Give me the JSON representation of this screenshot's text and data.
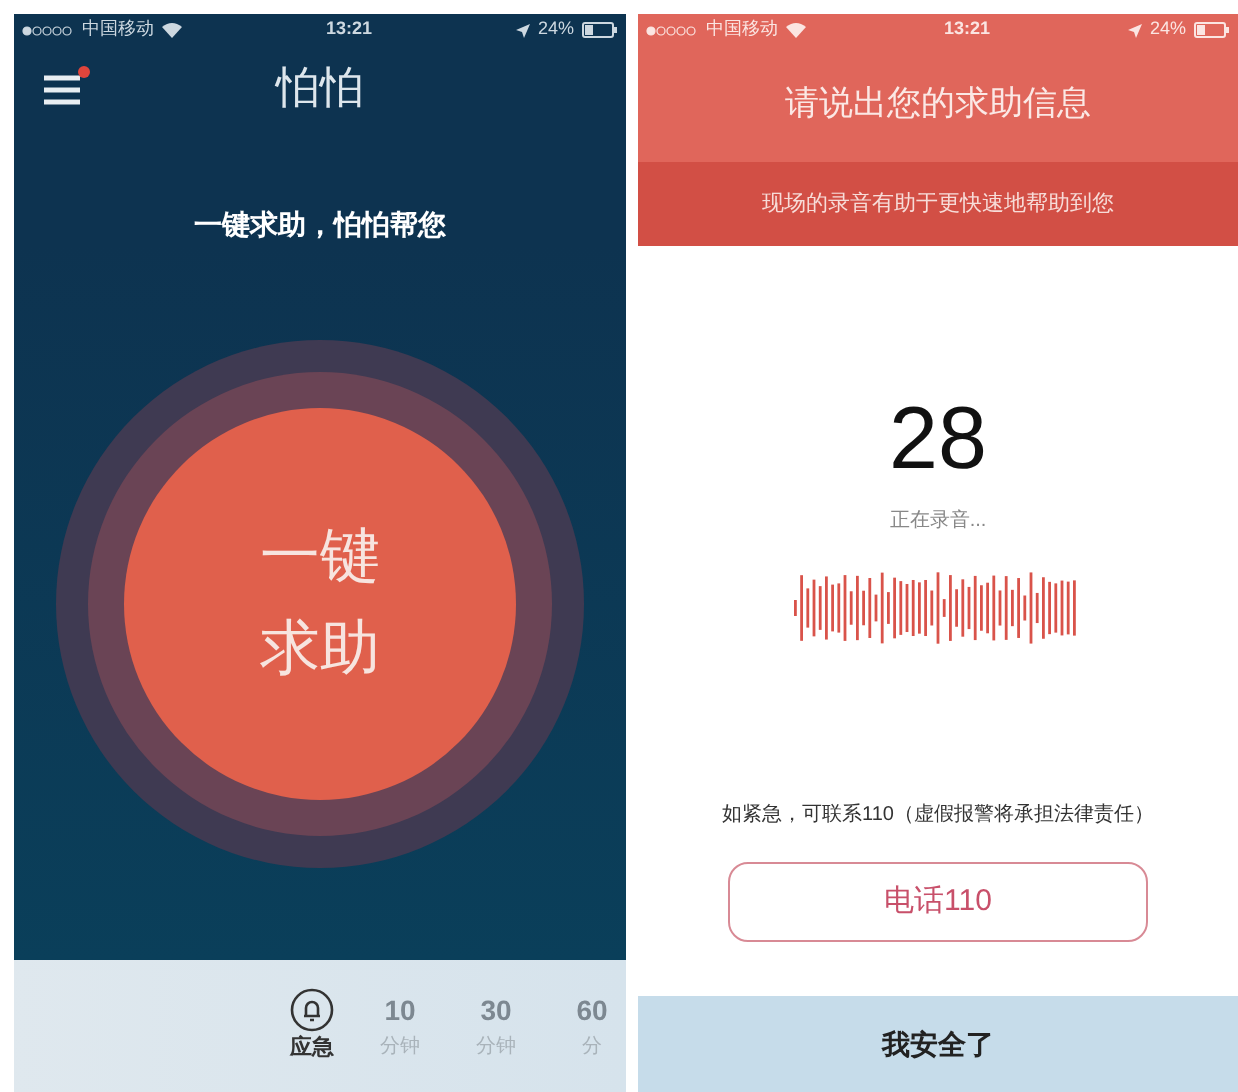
{
  "left_screen": {
    "status_bar": {
      "carrier": "中国移动",
      "time": "13:21",
      "battery": "24%"
    },
    "title": "怕怕",
    "slogan": "一键求助，怕怕帮您",
    "sos_button": {
      "line_1": "一键",
      "line_2": "求助"
    },
    "timer_options": [
      {
        "kind": "icon",
        "label": "应急",
        "selected": true
      },
      {
        "kind": "number",
        "value": "10",
        "unit": "分钟",
        "selected": false
      },
      {
        "kind": "number",
        "value": "30",
        "unit": "分钟",
        "selected": false
      },
      {
        "kind": "number",
        "value": "60",
        "unit": "分",
        "selected": false
      }
    ]
  },
  "right_screen": {
    "status_bar": {
      "carrier": "中国移动",
      "time": "13:21",
      "battery": "24%"
    },
    "title": "请说出您的求助信息",
    "subtitle": "现场的录音有助于更快速地帮助到您",
    "countdown": "28",
    "recording_status": "正在录音...",
    "notice": "如紧急，可联系110（虚假报警将承担法律责任）",
    "call_button": "电话110",
    "safe_button": "我安全了"
  }
}
